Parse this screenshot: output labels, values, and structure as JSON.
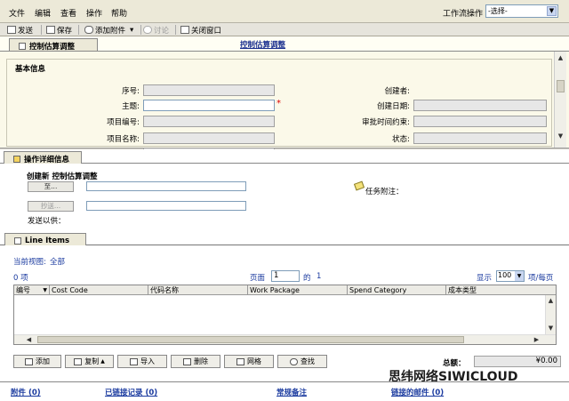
{
  "menu": [
    "文件",
    "编辑",
    "查看",
    "操作",
    "帮助"
  ],
  "workflow": {
    "label": "工作流操作",
    "select": "-选择-"
  },
  "toolbar": {
    "send": "发送",
    "save": "保存",
    "attach": "添加附件",
    "discuss": "讨论",
    "close": "关闭窗口"
  },
  "tab1": {
    "label": "控制估算调整",
    "center_title": "控制估算调整"
  },
  "basic": {
    "title": "基本信息",
    "fields": {
      "seq": "序号:",
      "subject": "主题:",
      "project_no": "项目编号:",
      "project_name": "项目名称:",
      "creator": "创建者:",
      "created_date": "创建日期:",
      "approval": "审批时间约束:",
      "status": "状态:"
    }
  },
  "tab2": {
    "label": "操作详细信息"
  },
  "detail": {
    "create_new": "创建新 控制估算调整",
    "to_btn": "至...",
    "cc_btn": "抄送...",
    "send_for": "发送以供：",
    "task_note": "任务附注："
  },
  "tab3": {
    "label": "Line Items"
  },
  "lines": {
    "current_view_label": "当前视图:",
    "current_view": "全部",
    "count": "0 项",
    "page_label": "页面",
    "page": "1",
    "of": "的",
    "total_pages": "1",
    "display_label": "显示",
    "per_page": "100",
    "per_page_unit": "项/每页",
    "columns": [
      "编号",
      "Cost Code",
      "代码名称",
      "Work Package",
      "Spend Category",
      "成本类型"
    ],
    "actions": {
      "add": "添加",
      "copy": "复制",
      "import": "导入",
      "delete": "删除",
      "grid": "网格",
      "find": "查找"
    },
    "total_label": "总额：",
    "total": "¥0.00"
  },
  "footer": {
    "attachments": "附件 (0)",
    "linked_records": "已链接记录 (0)",
    "remarks": "常规备注",
    "linked_mail": "链接的邮件 (0)"
  },
  "watermark": "思纬网络SIWICLOUD"
}
